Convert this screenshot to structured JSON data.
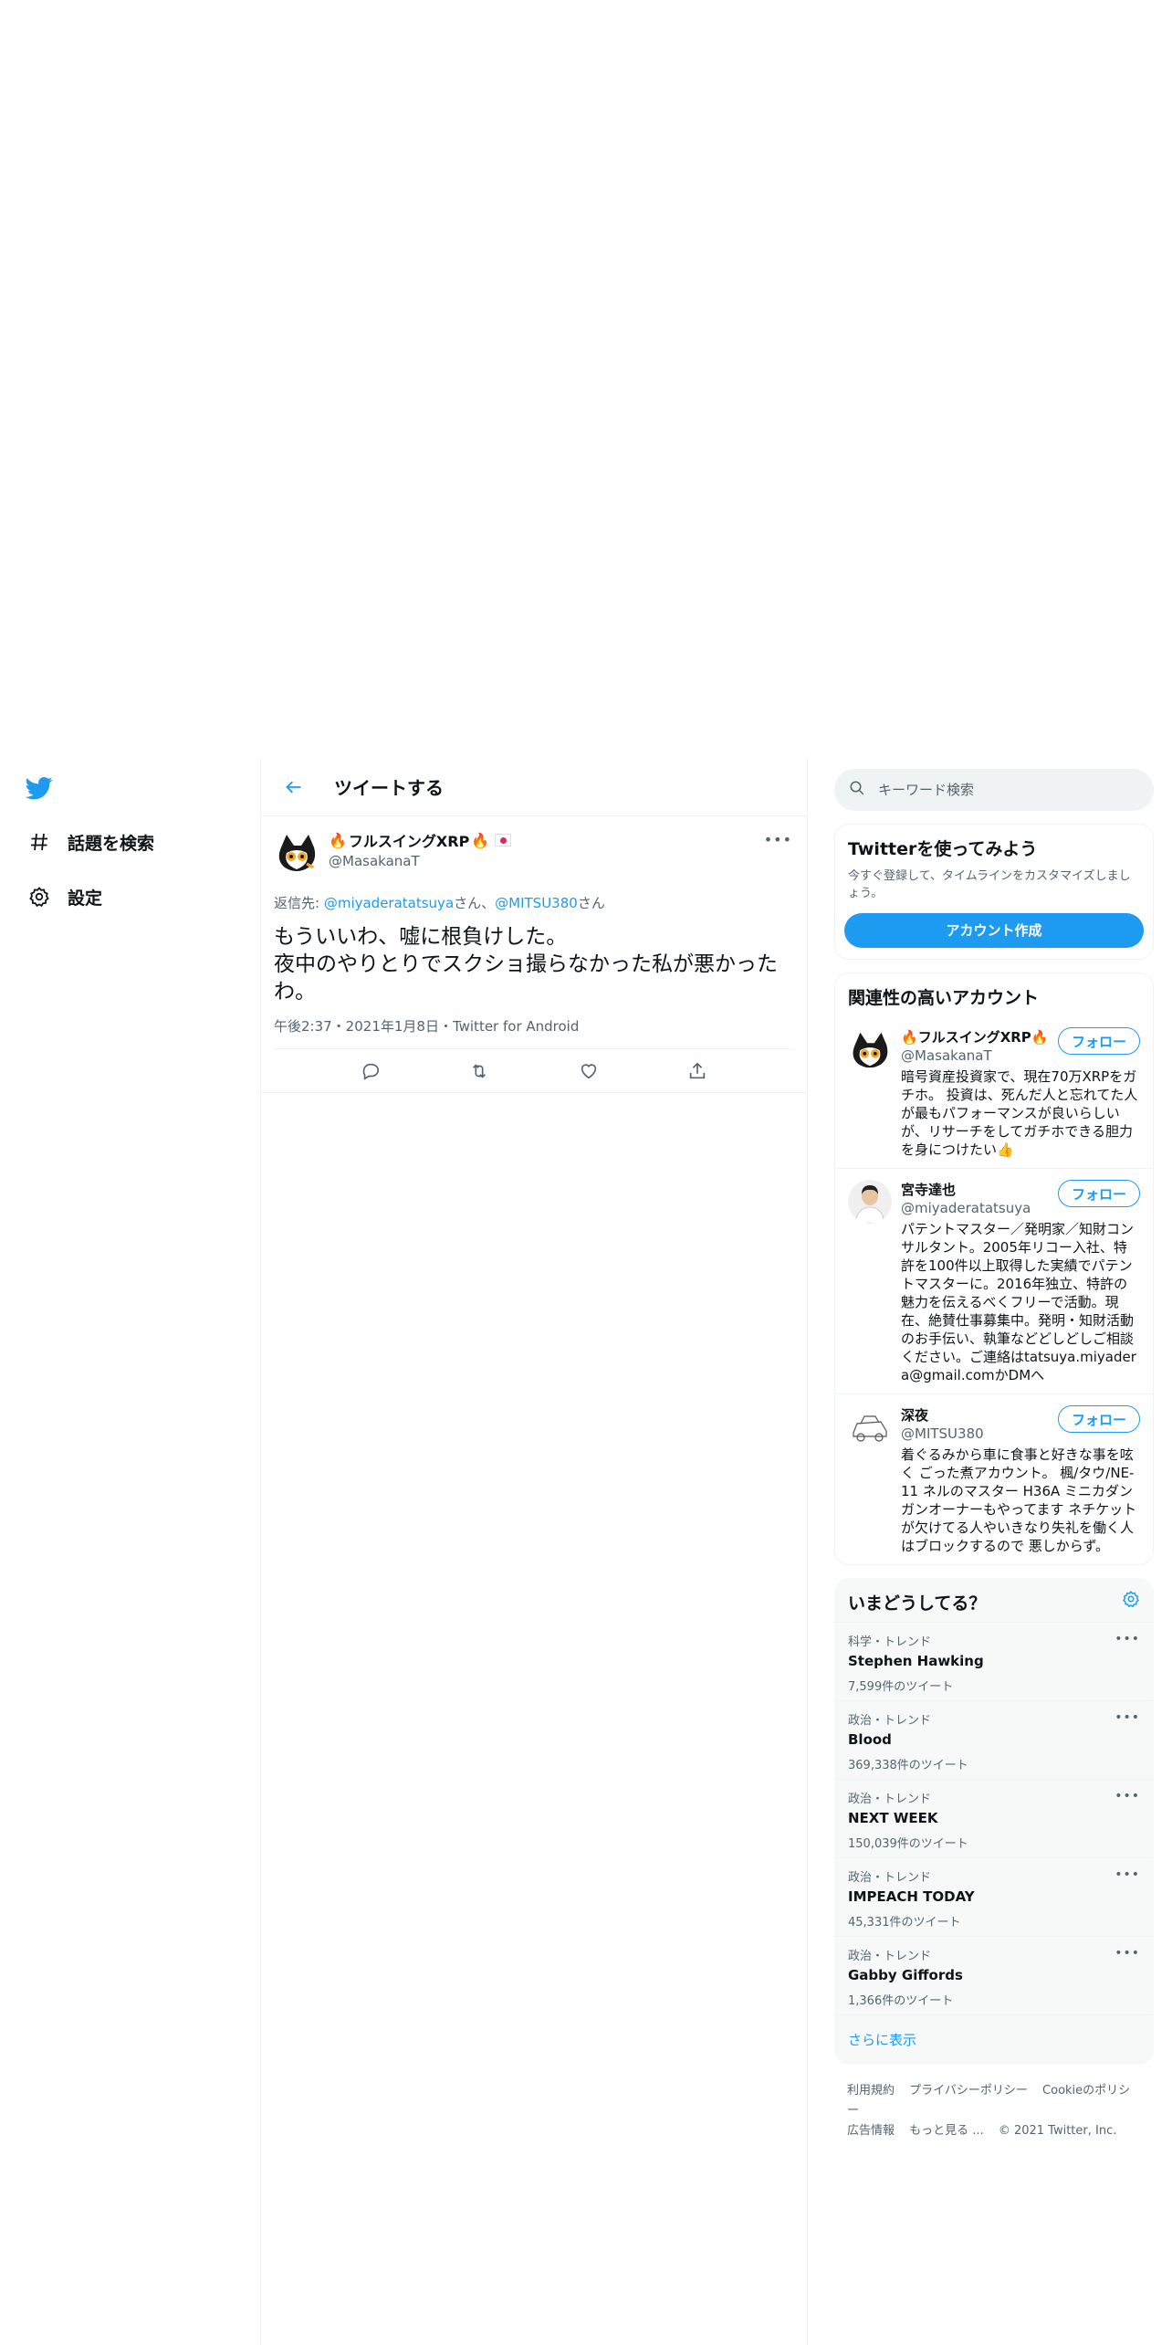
{
  "nav": {
    "explore_label": "話題を検索",
    "settings_label": "設定"
  },
  "header": {
    "title": "ツイートする"
  },
  "tweet": {
    "name": "フルスイングXRP",
    "handle": "@MasakanaT",
    "more": "•••",
    "reply_prefix": "返信先: ",
    "reply_user1": "@miyaderatatsuya",
    "reply_san1": "さん、",
    "reply_user2": "@MITSU380",
    "reply_san2": "さん",
    "text": "もういいわ、嘘に根負けした。\n夜中のやりとりでスクショ撮らなかった私が悪かったわ。",
    "meta": "午後2:37・2021年1月8日・Twitter for Android"
  },
  "search": {
    "placeholder": "キーワード検索"
  },
  "signup": {
    "title": "Twitterを使ってみよう",
    "subtitle": "今すぐ登録して、タイムラインをカスタマイズしましょう。",
    "button": "アカウント作成"
  },
  "related": {
    "title": "関連性の高いアカウント",
    "follow_label": "フォロー",
    "accounts": [
      {
        "name": "フルスイングXRP",
        "handle": "@MasakanaT",
        "bio": "暗号資産投資家で、現在70万XRPをガチホ。 投資は、死んだ人と忘れてた人が最もパフォーマンスが良いらしいが、リサーチをしてガチホできる胆力を身につけたい👍"
      },
      {
        "name": "宮寺達也",
        "handle": "@miyaderatatsuya",
        "bio": "パテントマスター／発明家／知財コンサルタント。2005年リコー入社、特許を100件以上取得した実績でパテントマスターに。2016年独立、特許の魅力を伝えるべくフリーで活動。現在、絶賛仕事募集中。発明・知財活動のお手伝い、執筆などどしどしご相談ください。ご連絡はtatsuya.miyadera@gmail.comかDMへ"
      },
      {
        "name": "深夜",
        "handle": "@MITSU380",
        "bio": "着ぐるみから車に食事と好きな事を呟く ごった煮アカウント。 楓/タウ/NE-11 ネルのマスター H36A ミニカダンガンオーナーもやってます ネチケットが欠けてる人やいきなり失礼を働く人はブロックするので 悪しからず。"
      }
    ]
  },
  "trends": {
    "title": "いまどうしてる？",
    "items": [
      {
        "category": "科学・トレンド",
        "name": "Stephen Hawking",
        "count": "7,599件のツイート"
      },
      {
        "category": "政治・トレンド",
        "name": "Blood",
        "count": "369,338件のツイート"
      },
      {
        "category": "政治・トレンド",
        "name": "NEXT WEEK",
        "count": "150,039件のツイート"
      },
      {
        "category": "政治・トレンド",
        "name": "IMPEACH TODAY",
        "count": "45,331件のツイート"
      },
      {
        "category": "政治・トレンド",
        "name": "Gabby Giffords",
        "count": "1,366件のツイート"
      }
    ],
    "show_more": "さらに表示"
  },
  "footer": {
    "terms": "利用規約",
    "privacy": "プライバシーポリシー",
    "cookie": "Cookieのポリシー",
    "ads": "広告情報",
    "more": "もっと見る ...",
    "copyright": "© 2021 Twitter, Inc."
  },
  "colors": {
    "accent": "#1d9bf0",
    "text": "#0f1419",
    "secondary": "#536471",
    "border": "#eff3f4"
  }
}
